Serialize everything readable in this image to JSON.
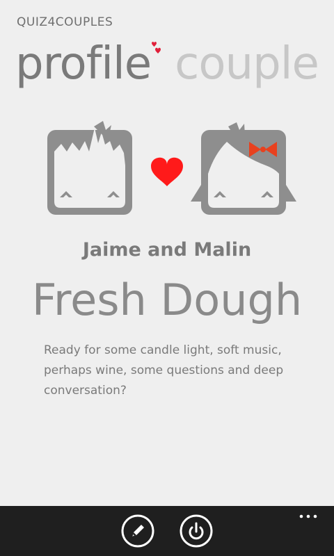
{
  "app": {
    "title": "QUIZ4COUPLES"
  },
  "pivot": {
    "items": [
      {
        "label": "profile",
        "active": true
      },
      {
        "label": "couple",
        "active": false
      }
    ]
  },
  "profile": {
    "names": "Jaime and Malin",
    "level": "Fresh Dough",
    "description": "Ready for some candle light, soft music, perhaps wine, some questions and deep conversation?"
  },
  "appbar": {
    "buttons": [
      {
        "icon": "pencil-icon"
      },
      {
        "icon": "power-icon"
      }
    ],
    "more_icon": "ellipsis-icon"
  },
  "colors": {
    "background": "#efefef",
    "avatar": "#8e8e8e",
    "heart": "#ff1a1a",
    "bow": "#e8411e",
    "appbar": "#1f1f1f"
  }
}
